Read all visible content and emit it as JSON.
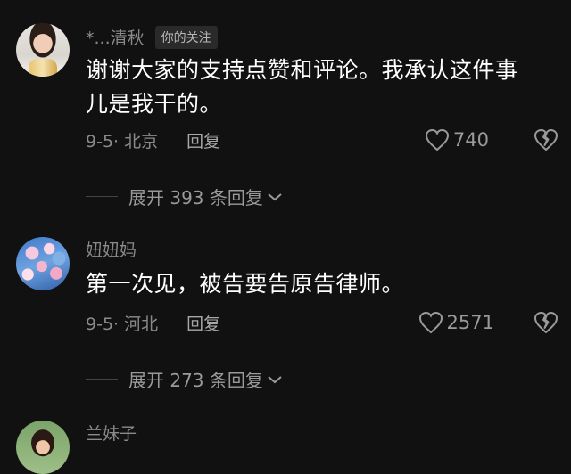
{
  "comments": [
    {
      "username": "*...清秋",
      "badge": "你的关注",
      "text_line1": "谢谢大家的支持点赞和评论。我承认这件事",
      "text_line2": "儿是我干的。",
      "time_location": "9-5· 北京",
      "reply_label": "回复",
      "likes": "740",
      "expand_label": "展开 393 条回复"
    },
    {
      "username": "妞妞妈",
      "text_line1": "第一次见，被告要告原告律师。",
      "time_location": "9-5· 河北",
      "reply_label": "回复",
      "likes": "2571",
      "expand_label": "展开 273 条回复"
    },
    {
      "username": "兰妹子"
    }
  ],
  "icons": {
    "like": "heart-outline-icon",
    "dislike": "broken-heart-icon",
    "expand": "chevron-down-icon"
  },
  "colors": {
    "background": "#111111",
    "text_primary": "#ffffff",
    "text_secondary": "#8a8a8a"
  }
}
